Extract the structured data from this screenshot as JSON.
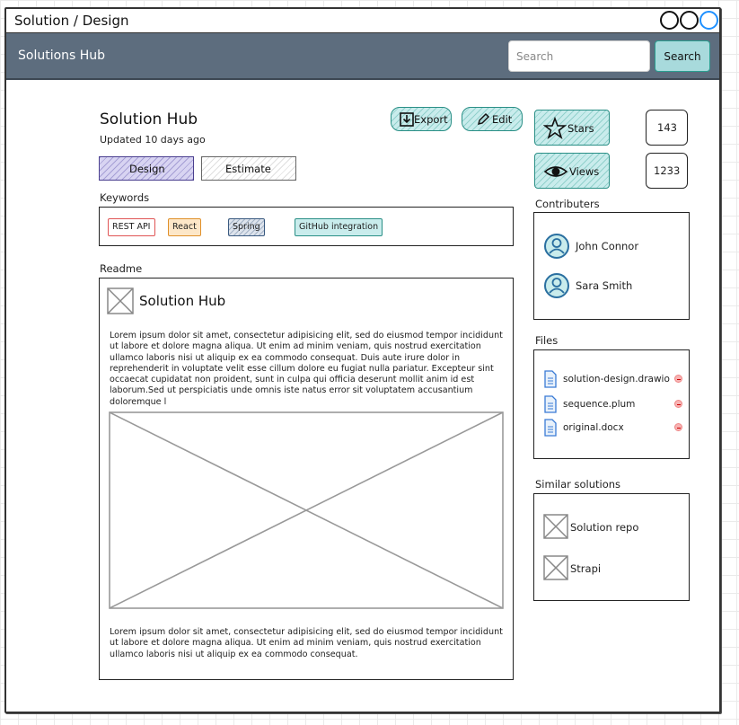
{
  "window": {
    "title": "Solution / Design"
  },
  "navbar": {
    "title": "Solutions Hub",
    "search_placeholder": "Search",
    "search_button": "Search"
  },
  "header": {
    "title": "Solution Hub",
    "updated": "Updated 10 days ago"
  },
  "actions": {
    "export": "Export",
    "edit": "Edit"
  },
  "tabs": [
    {
      "label": "Design",
      "active": true
    },
    {
      "label": "Estimate",
      "active": false
    }
  ],
  "keywords": {
    "label": "Keywords",
    "tags": [
      {
        "label": "REST API",
        "color": "#e05555"
      },
      {
        "label": "React",
        "color": "#e0902a"
      },
      {
        "label": "Spring",
        "color": "#3a5a80"
      },
      {
        "label": "GitHub integration",
        "color": "#2a8f86"
      }
    ]
  },
  "readme": {
    "label": "Readme",
    "title": "Solution Hub",
    "para1": "Lorem ipsum dolor sit amet, consectetur adipisicing elit, sed do eiusmod tempor incididunt ut labore et dolore magna aliqua. Ut enim ad minim veniam, quis nostrud exercitation ullamco laboris nisi ut aliquip ex ea commodo consequat. Duis aute irure dolor in reprehenderit in voluptate velit esse cillum dolore eu fugiat nulla pariatur. Excepteur sint occaecat cupidatat non proident, sunt in culpa qui officia deserunt mollit anim id est laborum.Sed ut perspiciatis unde omnis iste natus error sit voluptatem accusantium doloremque l",
    "para2": "Lorem ipsum dolor sit amet, consectetur adipisicing elit, sed do eiusmod tempor incididunt ut labore et dolore magna aliqua. Ut enim ad minim veniam, quis nostrud exercitation ullamco laboris nisi ut aliquip ex ea commodo consequat."
  },
  "stats": {
    "stars_label": "Stars",
    "stars_count": "143",
    "views_label": "Views",
    "views_count": "1233"
  },
  "contributors": {
    "label": "Contributers",
    "items": [
      {
        "name": "John Connor"
      },
      {
        "name": "Sara Smith"
      }
    ]
  },
  "files": {
    "label": "Files",
    "items": [
      {
        "name": "solution-design.drawio"
      },
      {
        "name": "sequence.plum"
      },
      {
        "name": "original.docx"
      }
    ]
  },
  "similar": {
    "label": "Similar solutions",
    "items": [
      {
        "name": "Solution repo"
      },
      {
        "name": "Strapi"
      }
    ]
  },
  "colors": {
    "navbar": "#5d6d7e",
    "accent": "#a8dadc",
    "accent_border": "#2a9d8f",
    "tab_active": "#c7c3ec",
    "window_control_active": "#1e90ff"
  }
}
